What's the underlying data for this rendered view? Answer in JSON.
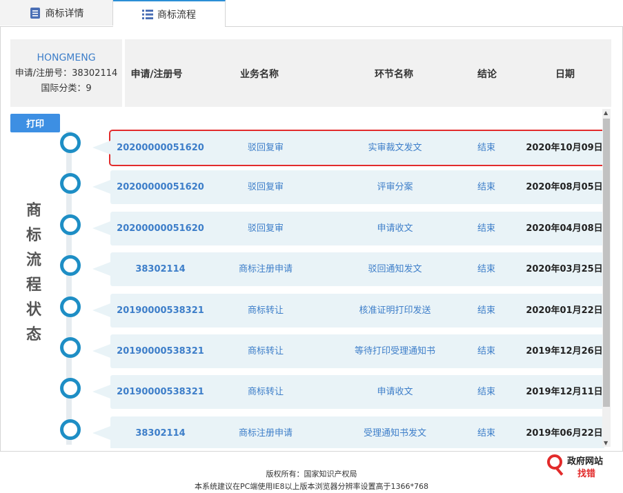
{
  "tabs": [
    {
      "label": "商标详情"
    },
    {
      "label": "商标流程"
    }
  ],
  "info": {
    "name": "HONGMENG",
    "reg_no": "申请/注册号：38302114",
    "class": "国际分类：9"
  },
  "headers": {
    "num": "申请/注册号",
    "biz": "业务名称",
    "step": "环节名称",
    "result": "结论",
    "date": "日期"
  },
  "print_label": "打印",
  "side_title": [
    "商",
    "标",
    "流",
    "程",
    "状",
    "态"
  ],
  "rows": [
    {
      "num": "20200000051620",
      "biz": "驳回复审",
      "step": "实审裁文发文",
      "result": "结束",
      "date": "2020年10月09日"
    },
    {
      "num": "20200000051620",
      "biz": "驳回复审",
      "step": "评审分案",
      "result": "结束",
      "date": "2020年08月05日"
    },
    {
      "num": "20200000051620",
      "biz": "驳回复审",
      "step": "申请收文",
      "result": "结束",
      "date": "2020年04月08日"
    },
    {
      "num": "38302114",
      "biz": "商标注册申请",
      "step": "驳回通知发文",
      "result": "结束",
      "date": "2020年03月25日"
    },
    {
      "num": "20190000538321",
      "biz": "商标转让",
      "step": "核准证明打印发送",
      "result": "结束",
      "date": "2020年01月22日"
    },
    {
      "num": "20190000538321",
      "biz": "商标转让",
      "step": "等待打印受理通知书",
      "result": "结束",
      "date": "2019年12月26日"
    },
    {
      "num": "20190000538321",
      "biz": "商标转让",
      "step": "申请收文",
      "result": "结束",
      "date": "2019年12月11日"
    },
    {
      "num": "38302114",
      "biz": "商标注册申请",
      "step": "受理通知书发文",
      "result": "结束",
      "date": "2019年06月22日"
    }
  ],
  "footer": {
    "copyright": "版权所有：国家知识产权局",
    "notice": "本系统建议在PC端使用IE8以上版本浏览器分辨率设置高于1366*768"
  },
  "badge": {
    "line1": "政府网站",
    "line2": "找错"
  },
  "colors": {
    "accent": "#3d7ec9",
    "dot": "#1e8ec5",
    "selection": "#e22b2b",
    "button": "#3d8fe3"
  }
}
